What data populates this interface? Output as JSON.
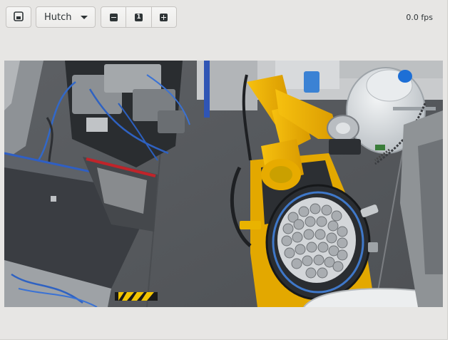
{
  "toolbar": {
    "save_icon": "save-snapshot-icon",
    "camera_select": {
      "selected": "Hutch"
    },
    "zoom": {
      "out_icon": "zoom-out-icon",
      "reset_label": "1",
      "in_icon": "zoom-in-icon"
    },
    "fps_text": "0.0 fps"
  },
  "video": {
    "description_icon": "camera-feed",
    "accent_colors": {
      "robot": "#f2b400",
      "floor": "#55585c",
      "dewar": "#dfe3e6",
      "cap": "#1d6fd6"
    }
  }
}
